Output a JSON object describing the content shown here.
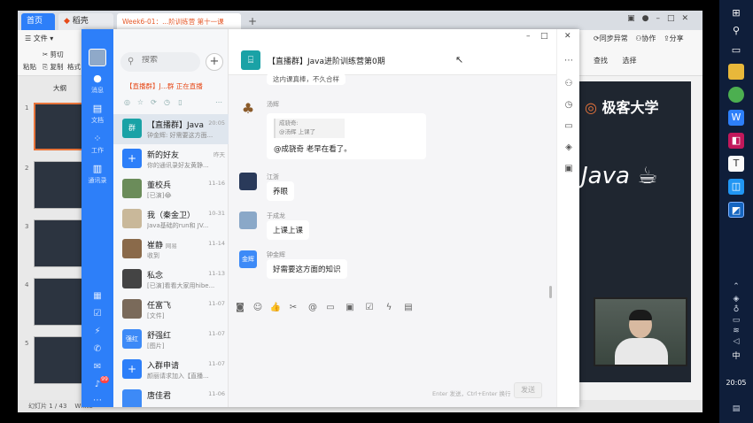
{
  "wps": {
    "tab_home": "首页",
    "tab_doc": "稻壳",
    "tab_file": "Week6-01：...阶训练营 第十一课",
    "tab_new": "+",
    "menu_file": "文件",
    "ribbon_cut": "剪切",
    "ribbon_copy": "复制",
    "ribbon_paste": "粘贴",
    "ribbon_format": "格式",
    "outline_label": "大纲",
    "slide_counter": "幻灯片 1 / 43",
    "status_theme": "White",
    "right_ribbon": [
      "同步异常",
      "协作",
      "分享"
    ],
    "right_ribbon2": [
      "查找",
      "选择"
    ],
    "brand": "极客大学",
    "java_logo": "Java"
  },
  "taskbar": {
    "lang": "中",
    "clock": "20:05"
  },
  "wx": {
    "nav": [
      {
        "icon": "chat-icon",
        "label": "消息"
      },
      {
        "icon": "doc-icon",
        "label": "文档"
      },
      {
        "icon": "work-icon",
        "label": "工作"
      },
      {
        "icon": "contacts-icon",
        "label": "通讯录"
      }
    ],
    "notification_count": "99",
    "search": {
      "placeholder": "搜索"
    },
    "live_bar": "【直播群】J...群 正在直播",
    "conversations": [
      {
        "name": "【直播群】Java...",
        "time": "20:05",
        "preview": "钟金辉: 好需要这方面...",
        "avatar_text": "群",
        "avatar_color": "#1aa2a6"
      },
      {
        "name": "新的好友",
        "time": "昨天",
        "preview": "你的通讯录好友黄静...",
        "avatar_text": "+",
        "avatar_color": "#2d7ff9"
      },
      {
        "name": "董校兵",
        "time": "11-16",
        "preview": "[已演]😂",
        "avatar_text": "",
        "avatar_color": "#6b8c5a"
      },
      {
        "name": "我（秦金卫）",
        "time": "10-31",
        "preview": "Java基础的run和 JV...",
        "avatar_text": "",
        "avatar_color": "#c9b89a"
      },
      {
        "name": "崔静",
        "time": "11-14",
        "preview": "收到",
        "avatar_text": "",
        "avatar_color": "#8a6a4a",
        "tag": "网易"
      },
      {
        "name": "私念",
        "time": "11-13",
        "preview": "[已演]看看大家用hibe...",
        "avatar_text": "",
        "avatar_color": "#444"
      },
      {
        "name": "任富飞",
        "time": "11-07",
        "preview": "[文件]",
        "avatar_text": "",
        "avatar_color": "#7a6a5a"
      },
      {
        "name": "舒强红",
        "time": "11-07",
        "preview": "[图片]",
        "avatar_text": "强红",
        "avatar_color": "#3d8af7"
      },
      {
        "name": "入群申请",
        "time": "11-07",
        "preview": "颜丽请求加入【直播...",
        "avatar_text": "+",
        "avatar_color": "#2d7ff9"
      },
      {
        "name": "唐佳君",
        "time": "11-06",
        "preview": "",
        "avatar_text": "",
        "avatar_color": "#3d8af7"
      }
    ],
    "chat": {
      "title": "【直播群】Java进阶训练营第0期",
      "messages": [
        {
          "name": "",
          "text": "这内课真棒，不久合样"
        },
        {
          "name": "汤辉",
          "quote_name": "成骁奇:",
          "quote_text": "@汤辉 上课了",
          "text": "@成骁奇 老早在看了。"
        },
        {
          "name": "江浙",
          "text": "养眼"
        },
        {
          "name": "于成龙",
          "text": "上课上课"
        },
        {
          "name": "钟金辉",
          "text": "好需要这方面的知识",
          "avatar_text": "金辉"
        }
      ],
      "input_hint": "Enter 发送，Ctrl+Enter 换行",
      "send_label": "发送"
    }
  }
}
